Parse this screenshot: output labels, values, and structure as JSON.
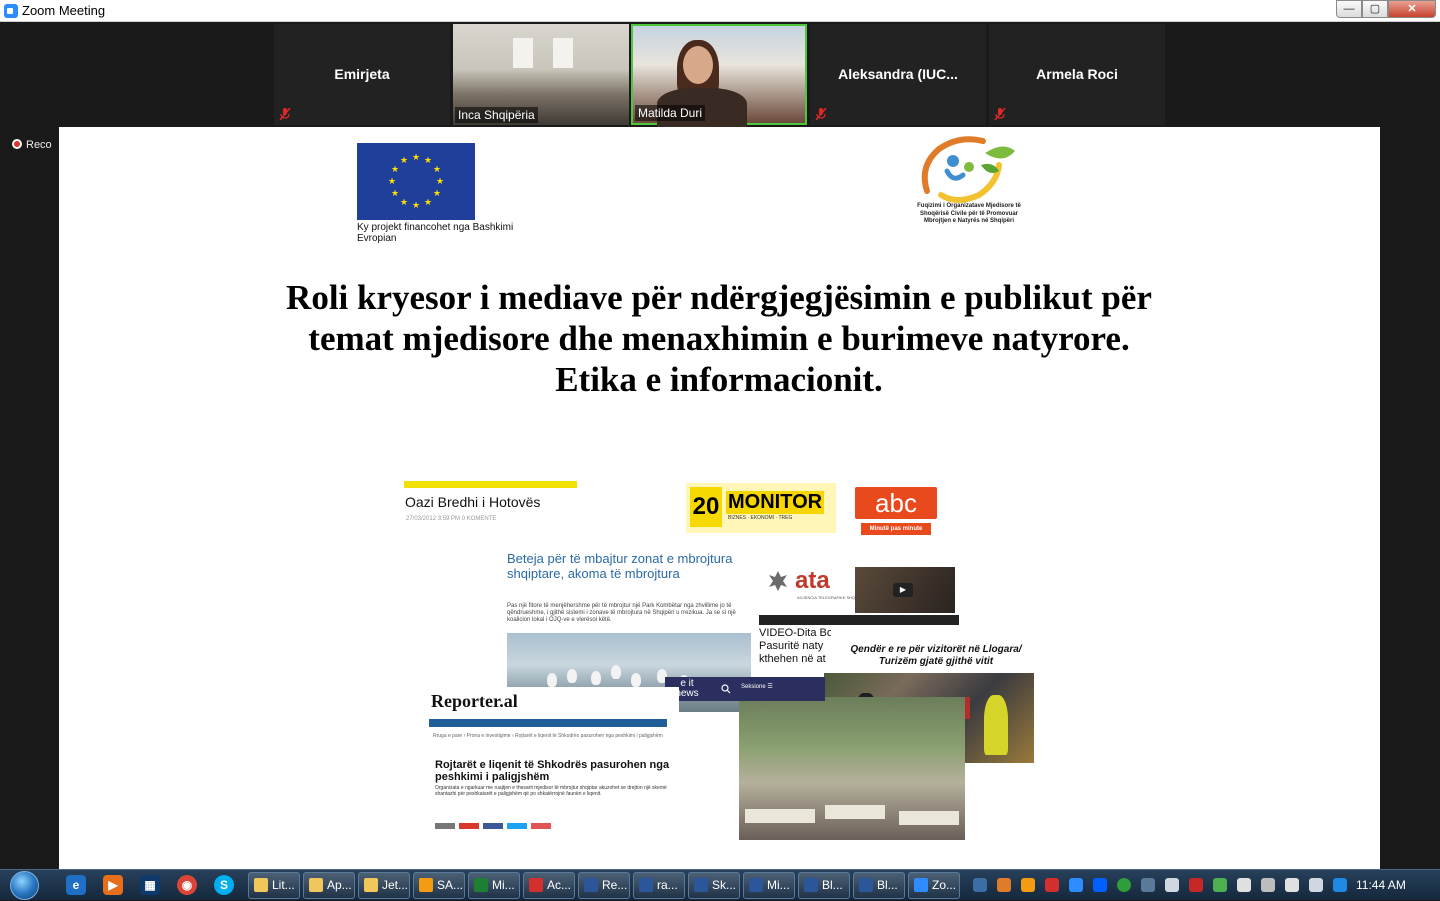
{
  "window": {
    "title": "Zoom Meeting",
    "minimize_label": "—",
    "maximize_label": "▢",
    "close_label": "✕"
  },
  "participants": [
    {
      "name": "Emirjeta",
      "muted": true
    },
    {
      "name": "Inca Shqipëria",
      "video": true
    },
    {
      "name": "Matilda Duri",
      "video": true,
      "active_speaker": true
    },
    {
      "name": "Aleksandra  (IUC...",
      "muted": true
    },
    {
      "name": "Armela Roci",
      "muted": true
    }
  ],
  "recording": {
    "label": "Reco"
  },
  "slide": {
    "eu_caption": "Ky projekt financohet nga Bashkimi Evropian",
    "partner_caption": "Fuqizimi i Organizatave Mjedisore të Shoqërisë Civile për të Promovuar Mbrojtjen e Natyrës në Shqipëri",
    "title_line1": "Roli kryesor i mediave për ndërgjegjësimin e publikut për",
    "title_line2": "temat mjedisore dhe menaxhimin e burimeve natyrore.",
    "title_line3": "Etika e informacionit.",
    "clips": {
      "oazi_headline": "Oazi Bredhi i Hotovës",
      "oazi_meta": "27/03/2012 3:59 PM        0 KOMENTE",
      "monitor_badge": "20",
      "monitor_name": "MONITOR",
      "monitor_sub": "BIZNES · EKONOMI · TREG",
      "abc_logo": "abc",
      "abc_tag": "Minutë pas minute",
      "beteja_headline": "Beteja për të mbajtur zonat e mbrojtura shqiptare, akoma të mbrojtura",
      "beteja_text": "Pas një fitore të menjëhershme për të mbrojtur një Park Kombëtar nga zhvillime jo të qëndrueshme, i gjithë sistemi i zonave të mbrojtura në Shqipëri u rrezikua. Ja se si një koalicion lokal i OJQ-ve e vlerësoi këtë.",
      "ata_logo": "ata",
      "ata_sub": "AGJENCIA TELEGRAFIKE SHQIPTARE",
      "video_line1": "VIDEO-Dita Botërore e Biodiversitetit/",
      "video_line2": "Pasuritë naty",
      "video_line3": "kthehen në at",
      "llogara_headline": "Qendër e re për vizitorët në Llogara/ Turizëm gjatë gjithë vitit",
      "eit_logo": "e it news",
      "eit_section": "Seksione ☰",
      "reporter_logo": "Reporter.al",
      "reporter_crumb": "Rruga e pare › Prona e investigime › Rojtarët e liqenit të Shkodrës pasurohen nga peshkimi i paligjshëm",
      "reporter_headline": "Rojtarët e liqenit të Shkodrës pasurohen nga peshkimi i paligjshëm",
      "reporter_text": "Organizata e ngarkuar me ruajtjen e thesarit mjedisor të mbrojtur shqiptar akuzohet se drejton një skemë shantazhi për peshkatarët e paligjshëm që po shkatërrojnë faunën e liqenit."
    }
  },
  "taskbar": {
    "buttons": [
      {
        "label": "Lit...",
        "color": "#f0c75a"
      },
      {
        "label": "Ap...",
        "color": "#f0c75a"
      },
      {
        "label": "Jet...",
        "color": "#f0c75a"
      },
      {
        "label": "SA...",
        "color": "#f39c12"
      },
      {
        "label": "Mi...",
        "color": "#1e7e34"
      },
      {
        "label": "Ac...",
        "color": "#d32f2f"
      },
      {
        "label": "Re...",
        "color": "#2b579a"
      },
      {
        "label": "ra...",
        "color": "#2b579a"
      },
      {
        "label": "Sk...",
        "color": "#2b579a"
      },
      {
        "label": "Mi...",
        "color": "#2b579a"
      },
      {
        "label": "Bl...",
        "color": "#2b579a"
      },
      {
        "label": "Bl...",
        "color": "#2b579a"
      },
      {
        "label": "Zo...",
        "color": "#2d8cff"
      }
    ],
    "clock": "11:44 AM"
  }
}
